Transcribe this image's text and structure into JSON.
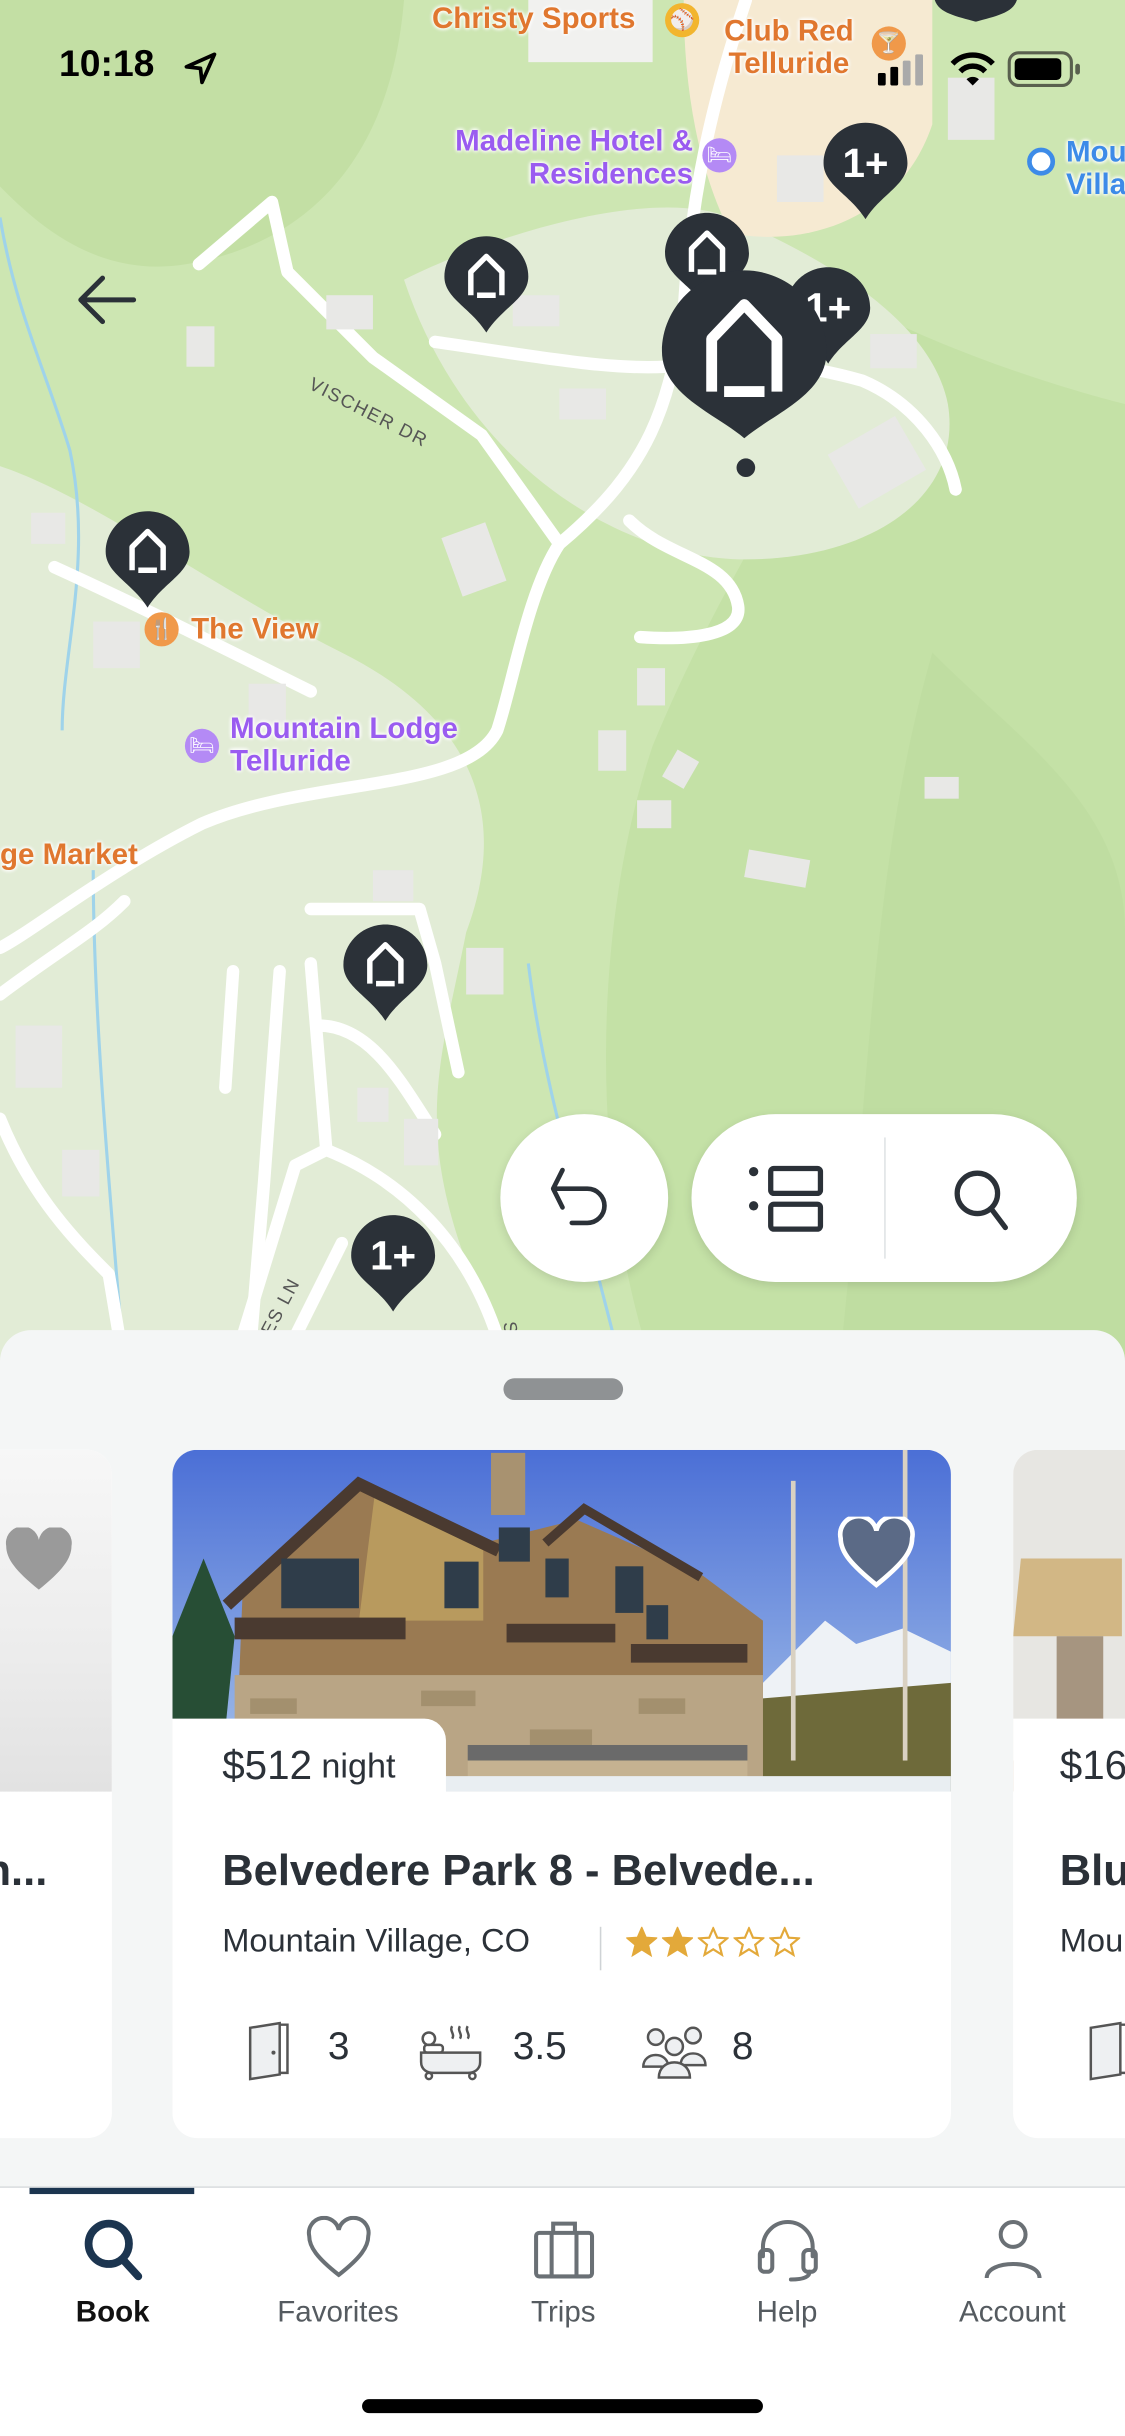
{
  "status_bar": {
    "time": "10:18",
    "location_icon": "location-arrow-icon",
    "signal": "signal-icon",
    "wifi": "wifi-icon",
    "battery": "battery-icon"
  },
  "map": {
    "labels": {
      "christy_sports": "Christy Sports",
      "club_red_1": "Club Red",
      "club_red_2": "Telluride",
      "madeline_1": "Madeline Hotel &",
      "madeline_2": "Residences",
      "mountain_village_1": "Mou",
      "mountain_village_2": "Villa",
      "the_view": "The View",
      "mountain_lodge_1": "Mountain Lodge",
      "mountain_lodge_2": "Telluride",
      "market": "ge Market",
      "vischer_dr": "VISCHER DR",
      "es_ln": "ES LN",
      "s_street": "S"
    },
    "cluster_label": "1+",
    "colors": {
      "pin": "#2b3138",
      "land": "#cfe8b5",
      "hotel": "#9a5cf0",
      "food": "#e0772f"
    }
  },
  "controls": {
    "back_icon": "arrow-left-icon",
    "undo_icon": "undo-icon",
    "list_icon": "list-view-icon",
    "search_icon": "search-icon"
  },
  "listings": [
    {
      "title": "n...",
      "price": "",
      "favorite": false
    },
    {
      "title": "Belvedere Park 8 - Belvede...",
      "price": "$512",
      "price_unit": "night",
      "location": "Mountain Village, CO",
      "rating": 2,
      "rating_max": 5,
      "bedrooms": "3",
      "bathrooms": "3.5",
      "guests": "8",
      "favorite": false
    },
    {
      "title": "Blu",
      "price": "$16",
      "location": "Mou"
    }
  ],
  "tabs": [
    {
      "label": "Book",
      "icon": "search-icon",
      "active": true
    },
    {
      "label": "Favorites",
      "icon": "heart-icon"
    },
    {
      "label": "Trips",
      "icon": "suitcase-icon"
    },
    {
      "label": "Help",
      "icon": "headset-icon"
    },
    {
      "label": "Account",
      "icon": "person-icon"
    }
  ],
  "accent": "#1c3550"
}
